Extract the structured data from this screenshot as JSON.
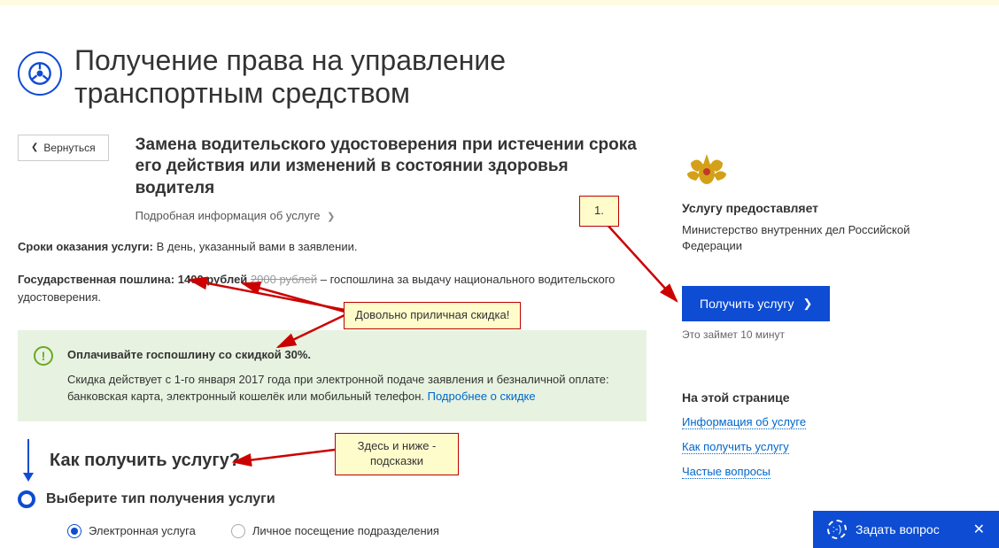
{
  "page": {
    "main_title": "Получение права на управление транспортным средством",
    "back_button": "Вернуться",
    "subtitle": "Замена водительского удостоверения при истечении срока его действия или изменений в состоянии здоровья водителя",
    "details_link": "Подробная информация об услуге",
    "timing_label": "Сроки оказания услуги:",
    "timing_value": "В день, указанный вами в заявлении.",
    "fee_label": "Государственная пошлина:",
    "fee_price": "1400 рублей",
    "fee_old_price": "2000 рублей",
    "fee_desc": "– госпошлина за выдачу национального водительского удостоверения."
  },
  "discount_panel": {
    "title": "Оплачивайте госпошлину со скидкой 30%.",
    "body": "Скидка действует с 1-го января 2017 года при электронной подаче заявления и безналичной оплате: банковская карта, электронный кошелёк или мобильный телефон. ",
    "link": "Подробнее о скидке"
  },
  "how": {
    "heading": "Как получить услугу?",
    "step1_title": "Выберите тип получения услуги",
    "opt_electronic": "Электронная услуга",
    "opt_personal": "Личное посещение подразделения"
  },
  "sidebar": {
    "provides_label": "Услугу предоставляет",
    "provider": "Министерство внутренних дел Российской Федерации",
    "cta": "Получить услугу",
    "eta": "Это займет 10 минут",
    "onpage_title": "На этой странице",
    "link1": "Информация об услуге",
    "link2": "Как получить услугу",
    "link3": "Частые вопросы"
  },
  "annotations": {
    "step_number": "1.",
    "discount_callout": "Довольно приличная скидка!",
    "hints_callout": "Здесь и ниже - подсказки"
  },
  "ask_bar": {
    "label": "Задать вопрос"
  }
}
